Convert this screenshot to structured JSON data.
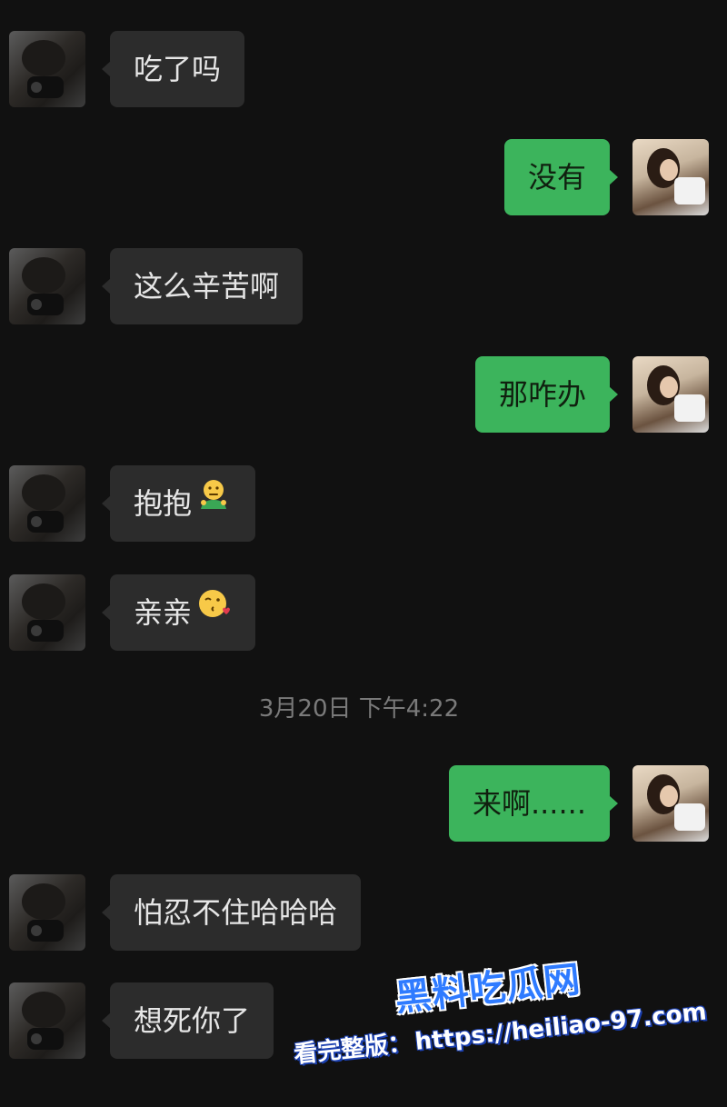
{
  "messages": [
    {
      "side": "left",
      "text": "吃了吗"
    },
    {
      "side": "right",
      "text": "没有"
    },
    {
      "side": "left",
      "text": "这么辛苦啊"
    },
    {
      "side": "right",
      "text": "那咋办"
    },
    {
      "side": "left",
      "text": "抱抱",
      "emoji": "hug-emoji"
    },
    {
      "side": "left",
      "text": "亲亲",
      "emoji": "kissing-heart-emoji"
    },
    {
      "side": "right",
      "text": "来啊......"
    },
    {
      "side": "left",
      "text": "怕忍不住哈哈哈"
    },
    {
      "side": "left",
      "text": "想死你了"
    }
  ],
  "timestamp": "3月20日 下午4:22",
  "watermark": {
    "logo": "黑料吃瓜网",
    "label": "看完整版：",
    "url": "https://heiliao-97.com"
  },
  "colors": {
    "background": "#111111",
    "incoming_bubble": "#2c2c2c",
    "outgoing_bubble": "#3cb45c",
    "timestamp_text": "#7a7a7a",
    "watermark_blue": "#2f7bff"
  }
}
